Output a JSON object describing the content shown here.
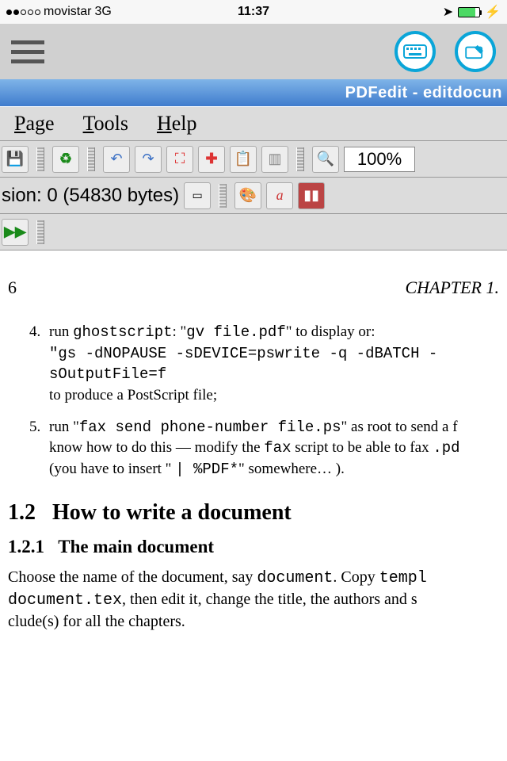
{
  "status": {
    "carrier": "movistar",
    "network": "3G",
    "time": "11:37"
  },
  "app": {
    "title": "PDFedit - editdocun"
  },
  "menu": {
    "page": "Page",
    "tools": "Tools",
    "help": "Help"
  },
  "toolbar": {
    "zoom": "100%",
    "revision": "sion: 0 (54830 bytes)"
  },
  "doc": {
    "page_num": "6",
    "chapter": "CHAPTER 1.",
    "item4_a": "run ",
    "item4_b": "ghostscript",
    "item4_c": ": \"",
    "item4_d": "gv file.pdf",
    "item4_e": "\" to display or:",
    "item4_f": "\"gs -dNOPAUSE -sDEVICE=pswrite -q -dBATCH -sOutputFile=f",
    "item4_g": "to produce a PostScript file;",
    "item5_a": "run \"",
    "item5_b": "fax send phone-number file.ps",
    "item5_c": "\" as root to send a f",
    "item5_d": "know how to do this — modify the ",
    "item5_e": "fax",
    "item5_f": " script to be able to fax ",
    "item5_g": ".pd",
    "item5_h": "(you have to insert \" ",
    "item5_i": "| %PDF*",
    "item5_j": "\" somewhere… ).",
    "sec_num": "1.2",
    "sec_title": "How to write a document",
    "sub_num": "1.2.1",
    "sub_title": "The main document",
    "para_a": "Choose the name of the document, say ",
    "para_b": "document",
    "para_c": ". Copy ",
    "para_d": "templ",
    "para_e": "document.tex",
    "para_f": ", then edit it, change the title, the authors and s",
    "para_g": "clude(s) for all the chapters."
  }
}
